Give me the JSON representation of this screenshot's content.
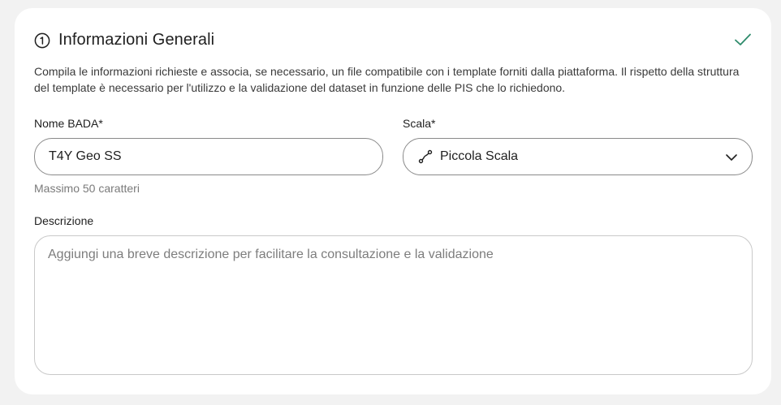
{
  "section": {
    "title": "Informazioni Generali",
    "description": "Compila le informazioni richieste e associa, se necessario, un file compatibile con i template forniti dalla piattaforma. Il rispetto della struttura del template è necessario per l'utilizzo e la validazione del dataset in funzione delle PIS che lo richiedono.",
    "step_icon": "circled-number-one-icon",
    "status_icon": "checkmark-icon",
    "accent_color": "#2e8b6b"
  },
  "form": {
    "name_field": {
      "label": "Nome BADA*",
      "value": "T4Y Geo SS",
      "hint": "Massimo 50 caratteri"
    },
    "scale_field": {
      "label": "Scala*",
      "value": "Piccola Scala",
      "icon": "route-icon",
      "dropdown_icon": "chevron-down-icon"
    },
    "description_field": {
      "label": "Descrizione",
      "placeholder": "Aggiungi una breve descrizione per facilitare la consultazione e la validazione"
    }
  }
}
